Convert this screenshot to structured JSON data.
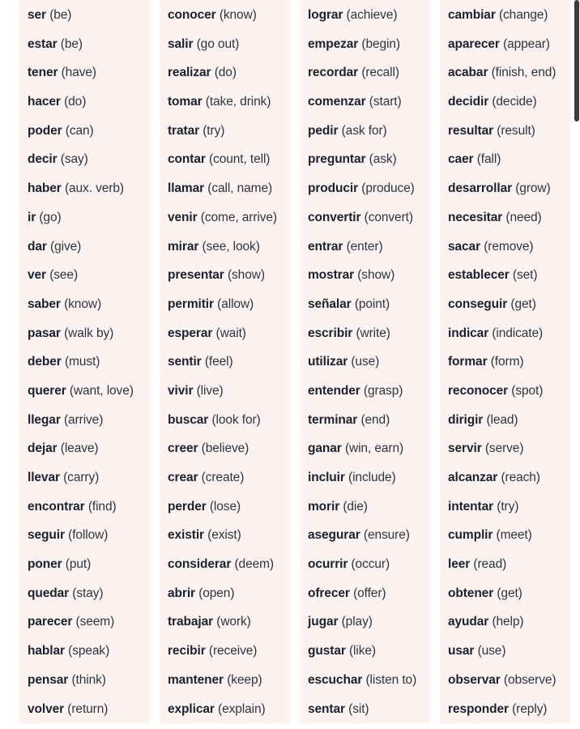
{
  "columns": [
    {
      "entries": [
        {
          "verb": "ser",
          "gloss": "(be)"
        },
        {
          "verb": "estar",
          "gloss": "(be)"
        },
        {
          "verb": "tener",
          "gloss": "(have)"
        },
        {
          "verb": "hacer",
          "gloss": "(do)"
        },
        {
          "verb": "poder",
          "gloss": "(can)"
        },
        {
          "verb": "decir",
          "gloss": "(say)"
        },
        {
          "verb": "haber",
          "gloss": "(aux. verb)"
        },
        {
          "verb": "ir",
          "gloss": "(go)"
        },
        {
          "verb": "dar",
          "gloss": "(give)"
        },
        {
          "verb": "ver",
          "gloss": "(see)"
        },
        {
          "verb": "saber",
          "gloss": "(know)"
        },
        {
          "verb": "pasar",
          "gloss": "(walk by)"
        },
        {
          "verb": "deber",
          "gloss": "(must)"
        },
        {
          "verb": "querer",
          "gloss": "(want, love)"
        },
        {
          "verb": "llegar",
          "gloss": "(arrive)"
        },
        {
          "verb": "dejar",
          "gloss": "(leave)"
        },
        {
          "verb": "llevar",
          "gloss": "(carry)"
        },
        {
          "verb": "encontrar",
          "gloss": "(find)"
        },
        {
          "verb": "seguir",
          "gloss": "(follow)"
        },
        {
          "verb": "poner",
          "gloss": "(put)"
        },
        {
          "verb": "quedar",
          "gloss": "(stay)"
        },
        {
          "verb": "parecer",
          "gloss": "(seem)"
        },
        {
          "verb": "hablar",
          "gloss": "(speak)"
        },
        {
          "verb": "pensar",
          "gloss": "(think)"
        },
        {
          "verb": "volver",
          "gloss": "(return)"
        }
      ]
    },
    {
      "entries": [
        {
          "verb": "conocer",
          "gloss": "(know)"
        },
        {
          "verb": "salir",
          "gloss": "(go out)"
        },
        {
          "verb": "realizar",
          "gloss": "(do)"
        },
        {
          "verb": "tomar",
          "gloss": "(take, drink)"
        },
        {
          "verb": "tratar",
          "gloss": "(try)"
        },
        {
          "verb": "contar",
          "gloss": "(count, tell)"
        },
        {
          "verb": "llamar",
          "gloss": "(call, name)"
        },
        {
          "verb": "venir",
          "gloss": "(come, arrive)"
        },
        {
          "verb": "mirar",
          "gloss": "(see, look)"
        },
        {
          "verb": "presentar",
          "gloss": "(show)"
        },
        {
          "verb": "permitir",
          "gloss": "(allow)"
        },
        {
          "verb": "esperar",
          "gloss": "(wait)"
        },
        {
          "verb": "sentir",
          "gloss": "(feel)"
        },
        {
          "verb": "vivir",
          "gloss": "(live)"
        },
        {
          "verb": "buscar",
          "gloss": "(look for)"
        },
        {
          "verb": "creer",
          "gloss": "(believe)"
        },
        {
          "verb": "crear",
          "gloss": "(create)"
        },
        {
          "verb": "perder",
          "gloss": "(lose)"
        },
        {
          "verb": "existir",
          "gloss": "(exist)"
        },
        {
          "verb": "considerar",
          "gloss": "(deem)"
        },
        {
          "verb": "abrir",
          "gloss": "(open)"
        },
        {
          "verb": "trabajar",
          "gloss": "(work)"
        },
        {
          "verb": "recibir",
          "gloss": "(receive)"
        },
        {
          "verb": "mantener",
          "gloss": "(keep)"
        },
        {
          "verb": "explicar",
          "gloss": "(explain)"
        }
      ]
    },
    {
      "entries": [
        {
          "verb": "lograr",
          "gloss": "(achieve)"
        },
        {
          "verb": "empezar",
          "gloss": "(begin)"
        },
        {
          "verb": "recordar",
          "gloss": "(recall)"
        },
        {
          "verb": "comenzar",
          "gloss": "(start)"
        },
        {
          "verb": "pedir",
          "gloss": "(ask for)"
        },
        {
          "verb": "preguntar",
          "gloss": "(ask)"
        },
        {
          "verb": "producir",
          "gloss": "(produce)"
        },
        {
          "verb": "convertir",
          "gloss": "(convert)"
        },
        {
          "verb": "entrar",
          "gloss": "(enter)"
        },
        {
          "verb": "mostrar",
          "gloss": "(show)"
        },
        {
          "verb": "señalar",
          "gloss": "(point)"
        },
        {
          "verb": "escribir",
          "gloss": "(write)"
        },
        {
          "verb": "utilizar",
          "gloss": "(use)"
        },
        {
          "verb": "entender",
          "gloss": "(grasp)"
        },
        {
          "verb": "terminar",
          "gloss": "(end)"
        },
        {
          "verb": "ganar",
          "gloss": "(win, earn)"
        },
        {
          "verb": "incluir",
          "gloss": "(include)"
        },
        {
          "verb": "morir",
          "gloss": "(die)"
        },
        {
          "verb": "asegurar",
          "gloss": "(ensure)"
        },
        {
          "verb": "ocurrir",
          "gloss": "(occur)"
        },
        {
          "verb": "ofrecer",
          "gloss": "(offer)"
        },
        {
          "verb": "jugar",
          "gloss": "(play)"
        },
        {
          "verb": "gustar",
          "gloss": "(like)"
        },
        {
          "verb": "escuchar",
          "gloss": "(listen to)"
        },
        {
          "verb": "sentar",
          "gloss": "(sit)"
        }
      ]
    },
    {
      "entries": [
        {
          "verb": "cambiar",
          "gloss": "(change)"
        },
        {
          "verb": "aparecer",
          "gloss": "(appear)"
        },
        {
          "verb": "acabar",
          "gloss": "(finish, end)"
        },
        {
          "verb": "decidir",
          "gloss": "(decide)"
        },
        {
          "verb": "resultar",
          "gloss": "(result)"
        },
        {
          "verb": "caer",
          "gloss": "(fall)"
        },
        {
          "verb": "desarrollar",
          "gloss": "(grow)"
        },
        {
          "verb": "necesitar",
          "gloss": "(need)"
        },
        {
          "verb": "sacar",
          "gloss": "(remove)"
        },
        {
          "verb": "establecer",
          "gloss": "(set)"
        },
        {
          "verb": "conseguir",
          "gloss": "(get)"
        },
        {
          "verb": "indicar",
          "gloss": "(indicate)"
        },
        {
          "verb": "formar",
          "gloss": "(form)"
        },
        {
          "verb": "reconocer",
          "gloss": "(spot)"
        },
        {
          "verb": "dirigir",
          "gloss": "(lead)"
        },
        {
          "verb": "servir",
          "gloss": "(serve)"
        },
        {
          "verb": "alcanzar",
          "gloss": "(reach)"
        },
        {
          "verb": "intentar",
          "gloss": "(try)"
        },
        {
          "verb": "cumplir",
          "gloss": "(meet)"
        },
        {
          "verb": "leer",
          "gloss": "(read)"
        },
        {
          "verb": "obtener",
          "gloss": "(get)"
        },
        {
          "verb": "ayudar",
          "gloss": "(help)"
        },
        {
          "verb": "usar",
          "gloss": "(use)"
        },
        {
          "verb": "observar",
          "gloss": "(observe)"
        },
        {
          "verb": "responder",
          "gloss": "(reply)"
        }
      ]
    }
  ],
  "colors": {
    "column_background": "#fcf3f0",
    "page_background": "#ffffff",
    "verb_text": "#1a2230",
    "gloss_text": "#2d3440",
    "scrollbar": "#3c3c3c"
  }
}
